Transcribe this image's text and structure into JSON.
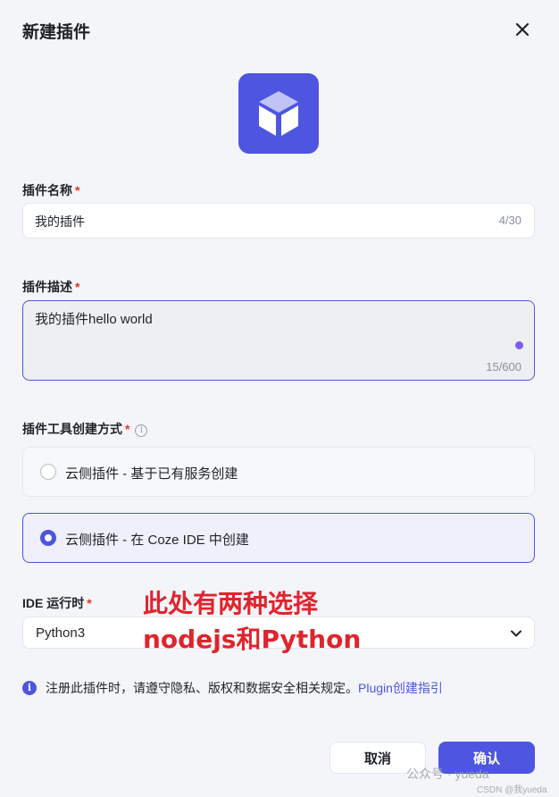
{
  "dialog": {
    "title": "新建插件"
  },
  "name_field": {
    "label": "插件名称",
    "required_mark": "*",
    "value": "我的插件",
    "count": "4/30"
  },
  "desc_field": {
    "label": "插件描述",
    "required_mark": "*",
    "value": "我的插件hello world",
    "count": "15/600"
  },
  "creation_mode": {
    "label": "插件工具创建方式",
    "required_mark": "*",
    "info_glyph": "i",
    "options": [
      {
        "label": "云侧插件 - 基于已有服务创建",
        "selected": false
      },
      {
        "label": "云侧插件 - 在 Coze IDE 中创建",
        "selected": true
      }
    ]
  },
  "runtime": {
    "label": "IDE 运行时",
    "required_mark": "*",
    "value": "Python3"
  },
  "annotation": {
    "line1": "此处有两种选择",
    "line2": "nodejs和Python"
  },
  "notice": {
    "icon_glyph": "i",
    "text": "注册此插件时，请遵守隐私、版权和数据安全相关规定。",
    "link": "Plugin创建指引"
  },
  "footer": {
    "cancel_label": "取消",
    "confirm_label": "确认"
  },
  "watermark": {
    "line1": "公众号 · yueda",
    "line2": "CSDN @我yueda"
  },
  "colors": {
    "accent": "#4e55e0",
    "required": "#e0342b",
    "annotation": "#e0242e"
  }
}
